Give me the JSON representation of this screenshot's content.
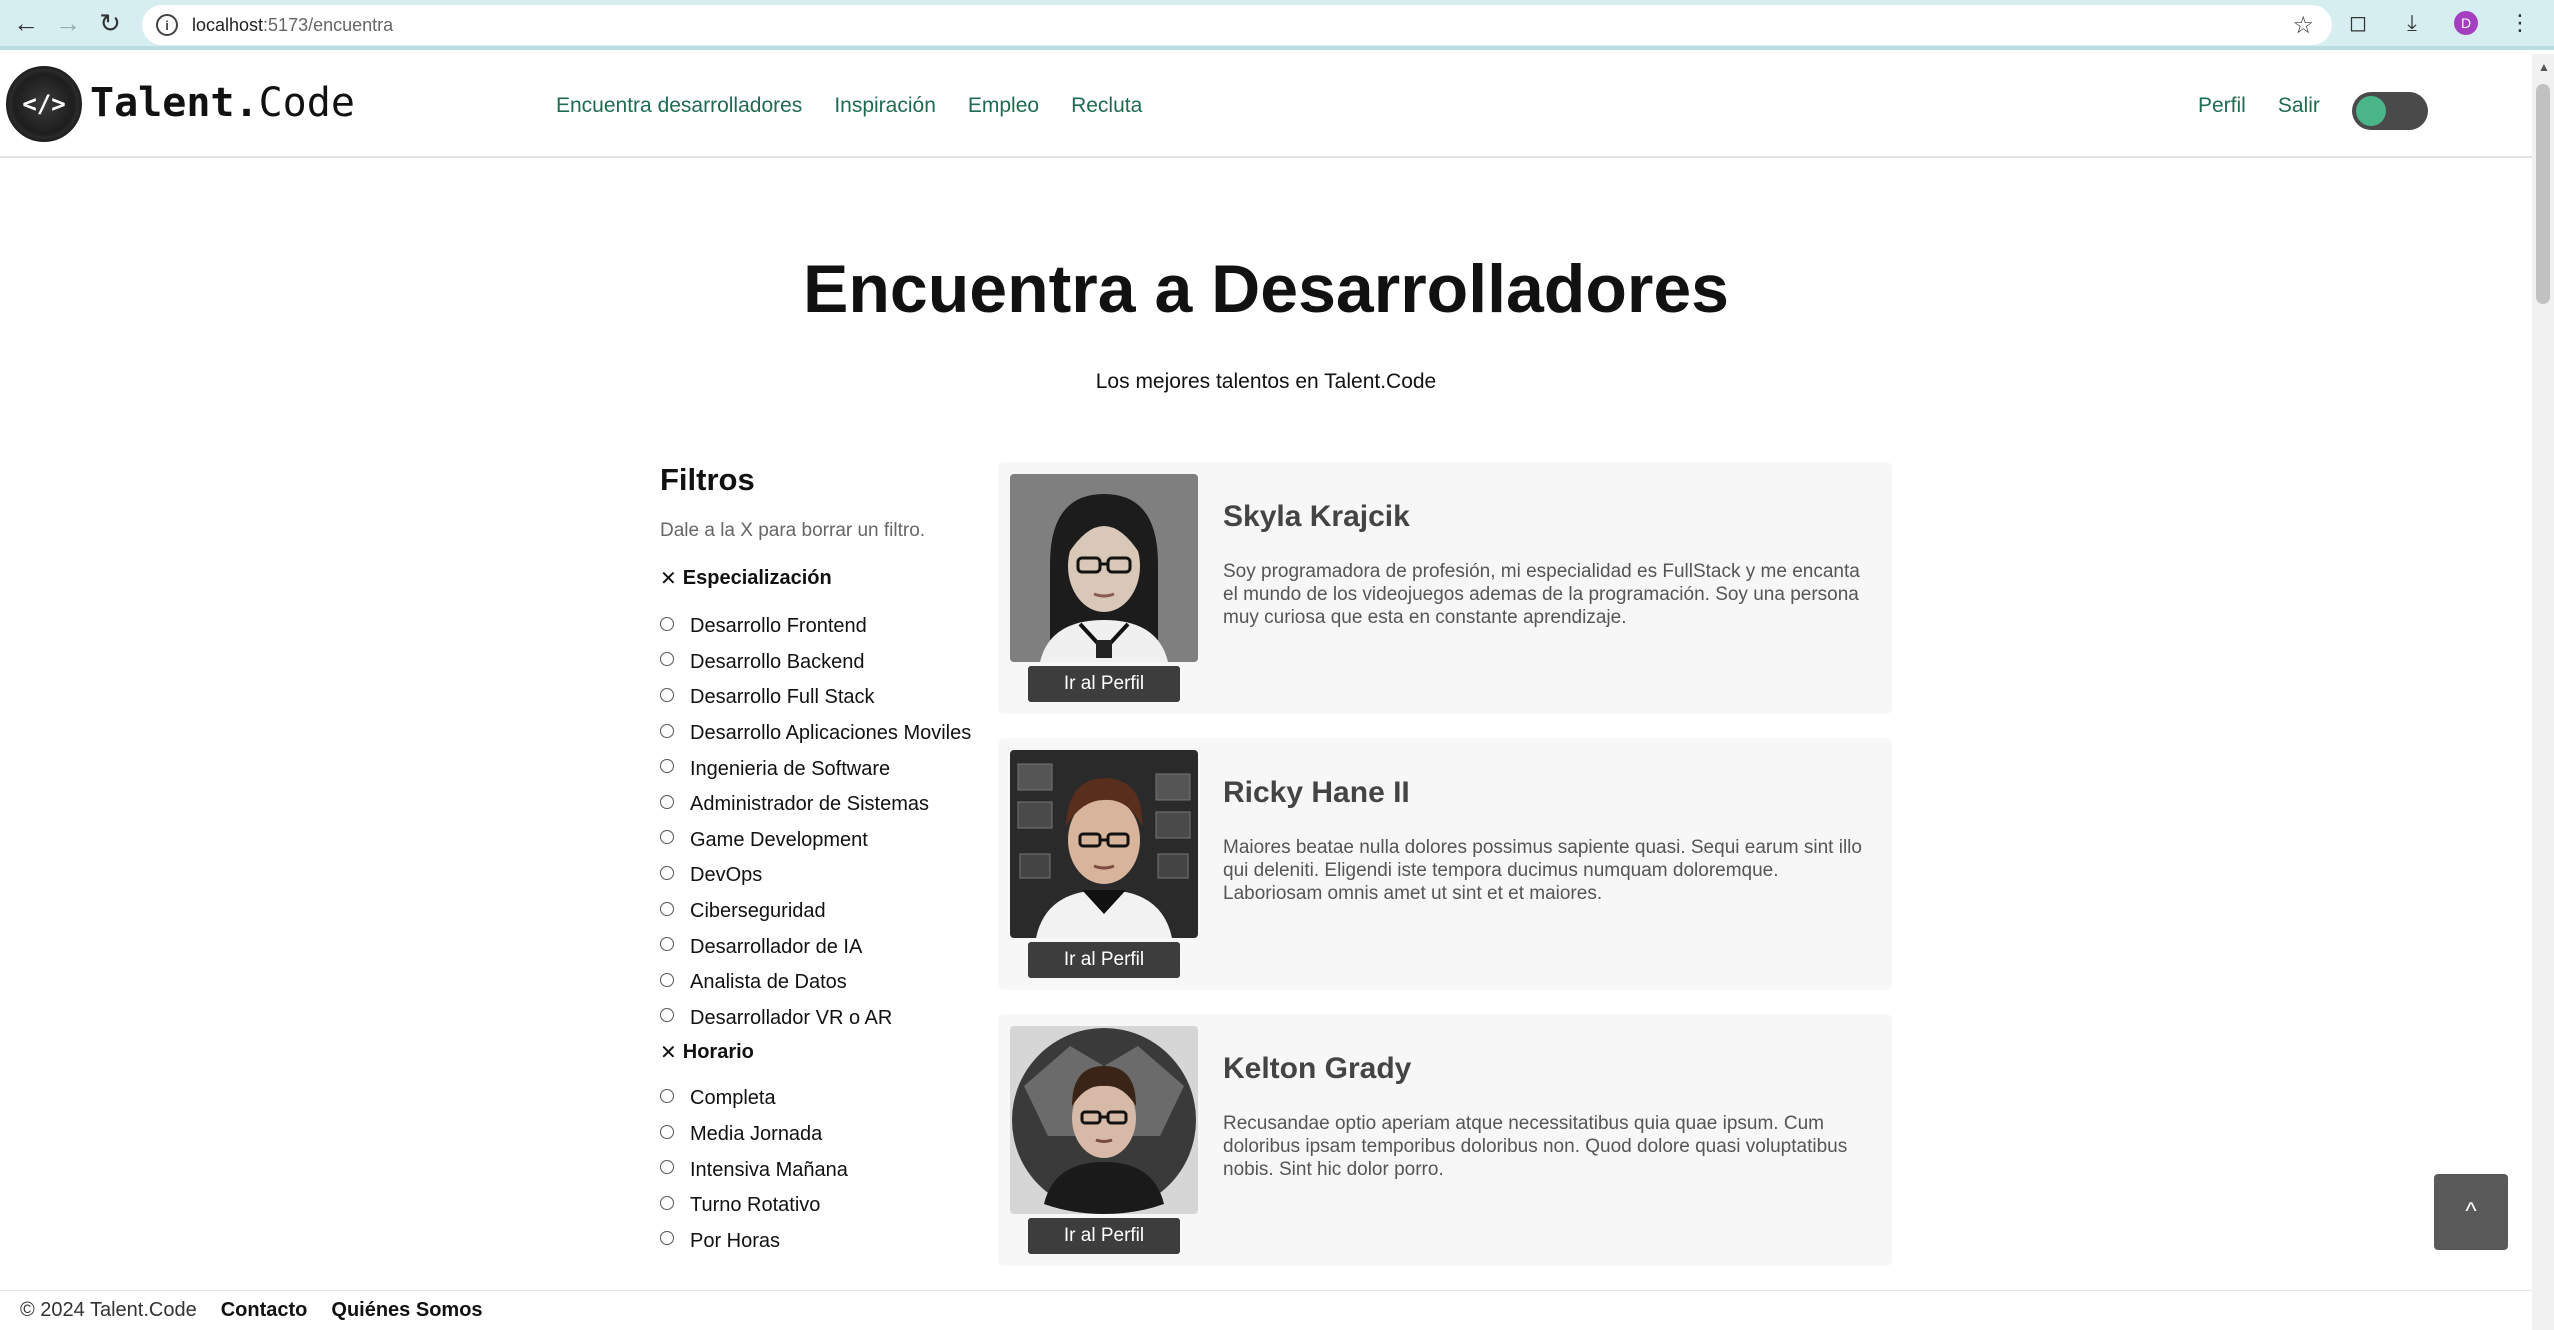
{
  "browser": {
    "url_host": "localhost",
    "url_path": ":5173/encuentra",
    "profile_initial": "D"
  },
  "header": {
    "logo_symbol": "</>",
    "logo_bold": "Talent.",
    "logo_light": "Code",
    "nav": [
      "Encuentra desarrolladores",
      "Inspiración",
      "Empleo",
      "Recluta"
    ],
    "right_nav": [
      "Perfil",
      "Salir"
    ],
    "theme_toggle_on": true,
    "accent_color": "#1f6b4e"
  },
  "hero": {
    "title": "Encuentra a Desarrolladores",
    "subtitle": "Los mejores talentos en Talent.Code"
  },
  "filters": {
    "title": "Filtros",
    "hint": "Dale a la X para borrar un filtro.",
    "clear_symbol": "✕",
    "groups": [
      {
        "label": "Especialización",
        "options": [
          "Desarrollo Frontend",
          "Desarrollo Backend",
          "Desarrollo Full Stack",
          "Desarrollo Aplicaciones Moviles",
          "Ingenieria de Software",
          "Administrador de Sistemas",
          "Game Development",
          "DevOps",
          "Ciberseguridad",
          "Desarrollador de IA",
          "Analista de Datos",
          "Desarrollador VR o AR"
        ]
      },
      {
        "label": "Horario",
        "options": [
          "Completa",
          "Media Jornada",
          "Intensiva Mañana",
          "Turno Rotativo",
          "Por Horas"
        ]
      }
    ]
  },
  "developers": [
    {
      "name": "Skyla Krajcik",
      "bio": "Soy programadora de profesión, mi especialidad es FullStack y me encanta el mundo de los videojuegos ademas de la programación. Soy una persona muy curiosa que esta en constante aprendizaje.",
      "button": "Ir al Perfil"
    },
    {
      "name": "Ricky Hane II",
      "bio": "Maiores beatae nulla dolores possimus sapiente quasi. Sequi earum sint illo qui deleniti. Eligendi iste tempora ducimus numquam doloremque. Laboriosam omnis amet ut sint et et maiores.",
      "button": "Ir al Perfil"
    },
    {
      "name": "Kelton Grady",
      "bio": "Recusandae optio aperiam atque necessitatibus quia quae ipsum. Cum doloribus ipsam temporibus doloribus non. Quod dolore quasi voluptatibus nobis. Sint hic dolor porro.",
      "button": "Ir al Perfil"
    }
  ],
  "back_to_top": "^",
  "footer": {
    "copyright": "© 2024 Talent.Code",
    "links": [
      "Contacto",
      "Quiénes Somos"
    ]
  }
}
